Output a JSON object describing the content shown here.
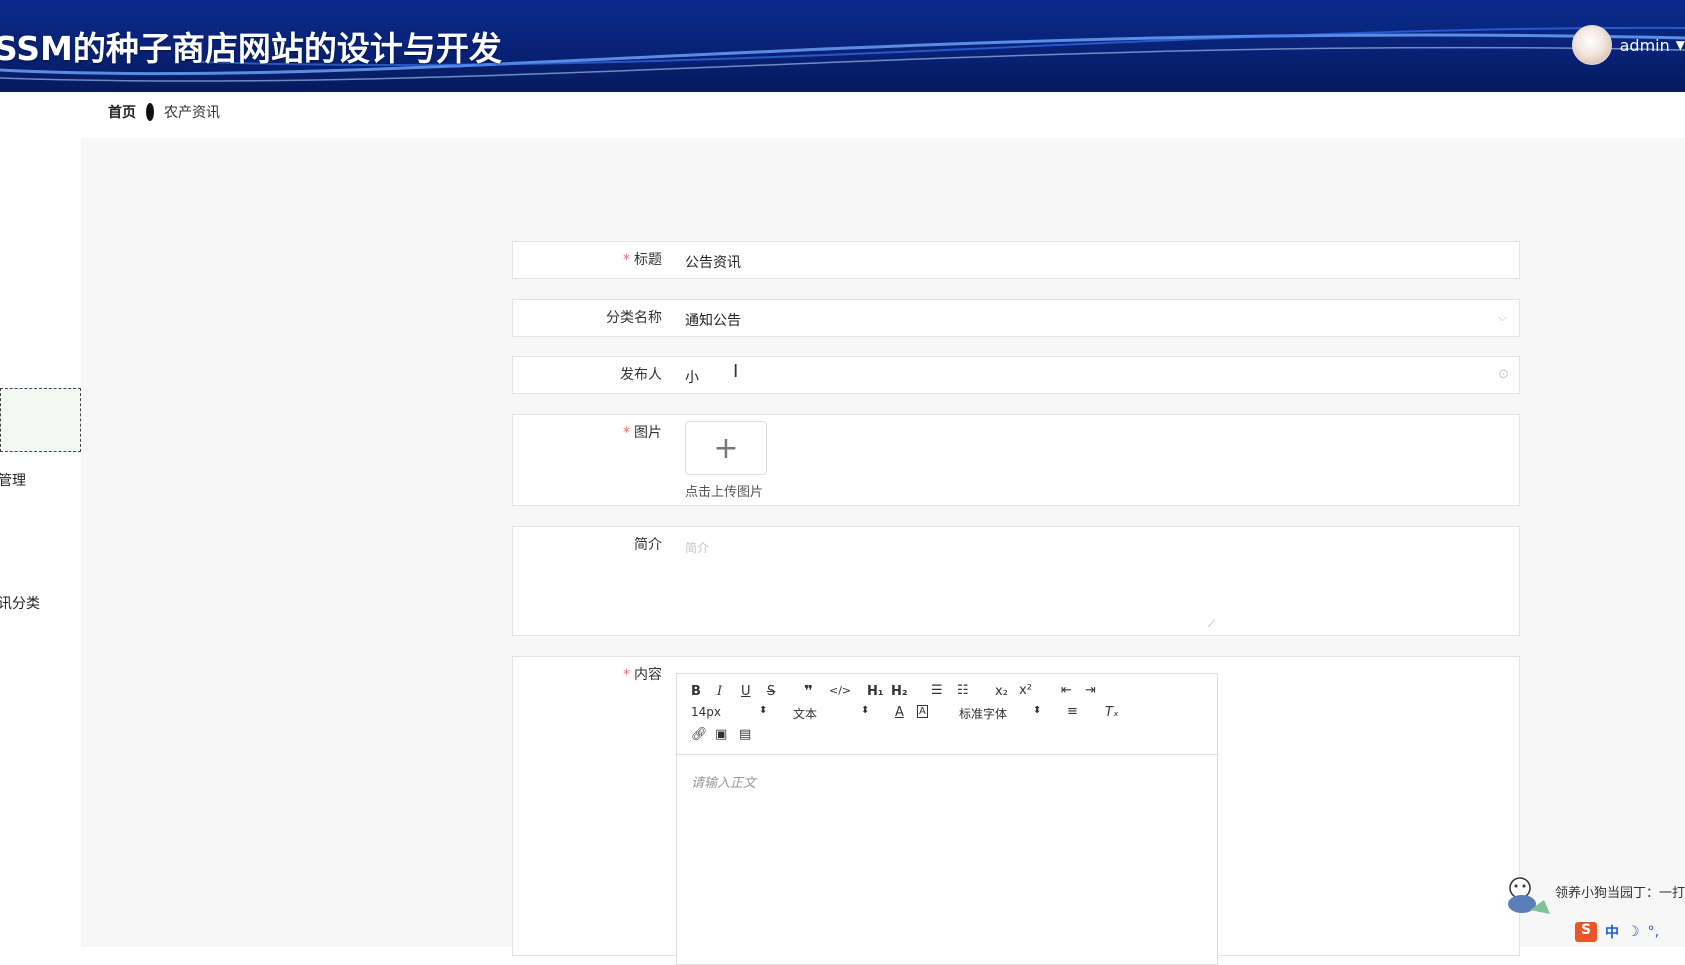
{
  "header": {
    "title": "SSM的种子商店网站的设计与开发",
    "user": "admin"
  },
  "breadcrumb": {
    "home": "首页",
    "current": "农产资讯"
  },
  "sidebar": {
    "items": [
      "",
      "",
      "",
      "",
      "",
      "管理",
      "",
      "讯分类",
      "",
      "",
      "",
      ""
    ]
  },
  "form": {
    "title_label": "标题",
    "title_value": "公告资讯",
    "category_label": "分类名称",
    "category_value": "通知公告",
    "publisher_label": "发布人",
    "publisher_value": "小",
    "image_label": "图片",
    "upload_plus": "+",
    "upload_hint": "点击上传图片",
    "intro_label": "简介",
    "intro_placeholder": "简介",
    "content_label": "内容",
    "editor": {
      "font_size": "14px",
      "text_style": "文本",
      "font_family": "标准字体",
      "placeholder": "请输入正文"
    }
  },
  "widget": {
    "text": "领养小狗当园丁：一打"
  },
  "ime": {
    "lang": "中"
  },
  "colors": {
    "header_bg": "#0a2a8c",
    "required": "#f56c6c"
  }
}
